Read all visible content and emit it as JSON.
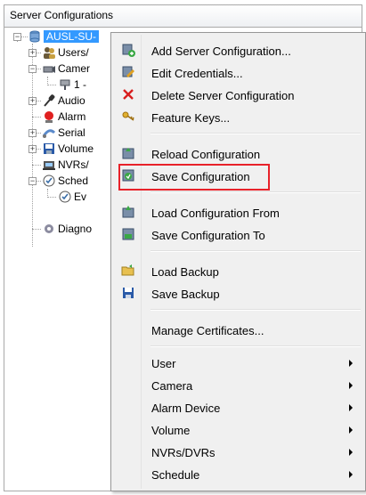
{
  "panel": {
    "title": "Server Configurations"
  },
  "tree": {
    "root_label": "AUSL-SU-",
    "items": [
      {
        "label": "Users/"
      },
      {
        "label": "Camer"
      },
      {
        "label": "1 -"
      },
      {
        "label": "Audio"
      },
      {
        "label": "Alarm"
      },
      {
        "label": "Serial"
      },
      {
        "label": "Volume"
      },
      {
        "label": "NVRs/"
      },
      {
        "label": "Sched"
      },
      {
        "label": "Ev"
      },
      {
        "label": "Diagno"
      }
    ]
  },
  "menu": {
    "items": [
      {
        "label": "Add Server Configuration...",
        "icon": "server-add-icon"
      },
      {
        "label": "Edit Credentials...",
        "icon": "server-edit-icon"
      },
      {
        "label": "Delete Server Configuration",
        "icon": "delete-x-icon"
      },
      {
        "label": "Feature Keys...",
        "icon": "keys-icon"
      },
      {
        "label": "Reload Configuration",
        "icon": "reload-icon"
      },
      {
        "label": "Save Configuration",
        "icon": "save-config-icon"
      },
      {
        "label": "Load Configuration From",
        "icon": "load-from-icon"
      },
      {
        "label": "Save Configuration To",
        "icon": "save-to-icon"
      },
      {
        "label": "Load Backup",
        "icon": "folder-open-icon"
      },
      {
        "label": "Save Backup",
        "icon": "floppy-icon"
      },
      {
        "label": "Manage Certificates..."
      },
      {
        "label": "User"
      },
      {
        "label": "Camera"
      },
      {
        "label": "Alarm Device"
      },
      {
        "label": "Volume"
      },
      {
        "label": "NVRs/DVRs"
      },
      {
        "label": "Schedule"
      }
    ]
  },
  "colors": {
    "highlight": "#e8222a",
    "selection": "#3399ff",
    "menu_bg": "#f0f0f0"
  }
}
